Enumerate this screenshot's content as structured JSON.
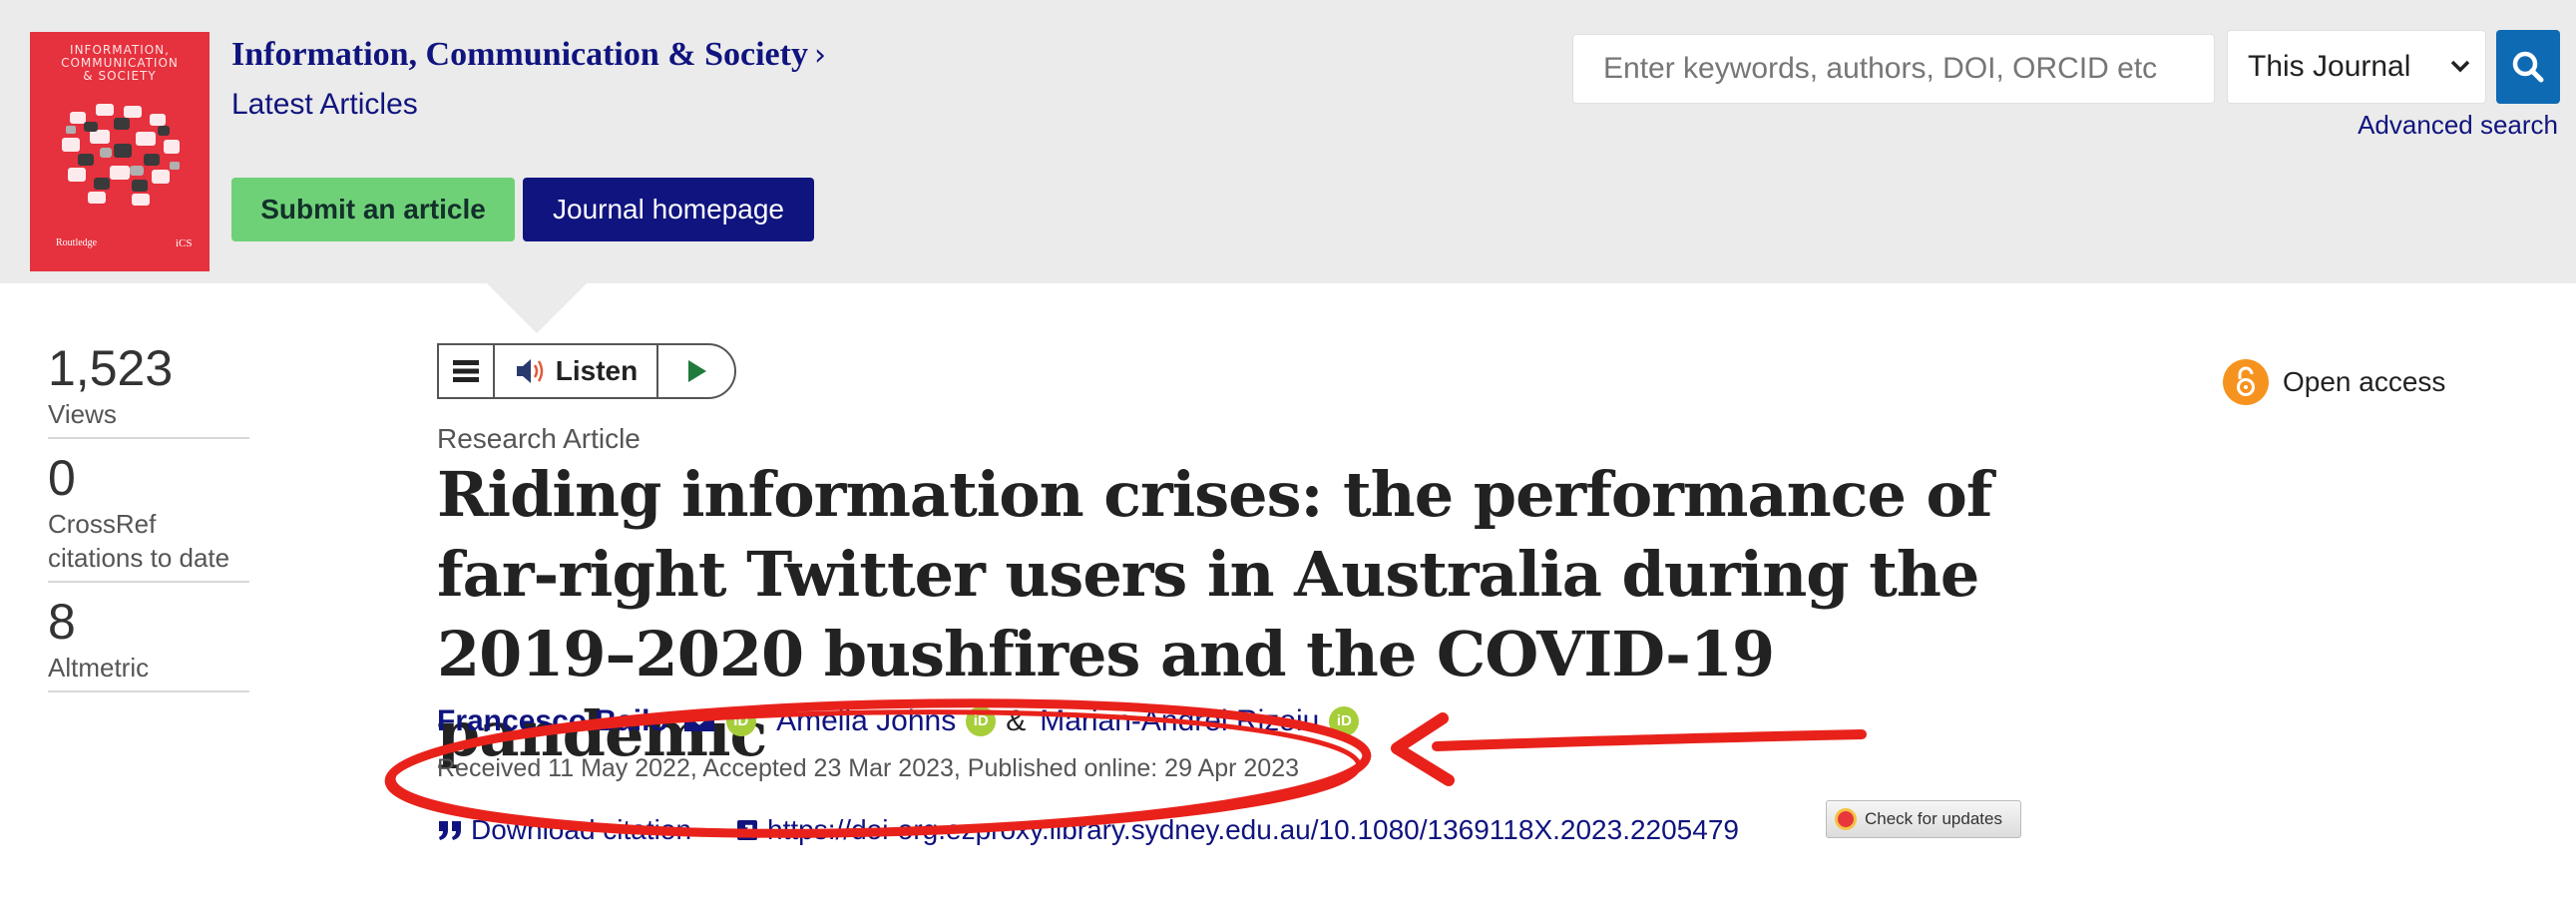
{
  "journal": {
    "cover_title_line1": "INFORMATION,",
    "cover_title_line2": "COMMUNICATION",
    "cover_title_line3": "& SOCIETY",
    "cover_publisher": "Routledge",
    "cover_abbr": "iCS",
    "title": "Information, Communication & Society",
    "title_chevron": "›",
    "subtitle": "Latest Articles",
    "submit_label": "Submit an article",
    "homepage_label": "Journal homepage"
  },
  "search": {
    "placeholder": "Enter keywords, authors, DOI, ORCID etc",
    "scope_value": "This Journal",
    "advanced_label": "Advanced search"
  },
  "metrics": [
    {
      "value": "1,523",
      "label": "Views"
    },
    {
      "value": "0",
      "label": "CrossRef citations to date"
    },
    {
      "value": "8",
      "label": "Altmetric"
    }
  ],
  "listen": {
    "label": "Listen"
  },
  "access": {
    "label": "Open access"
  },
  "article": {
    "type": "Research Article",
    "title": "Riding information crises: the performance of far-right Twitter users in Australia during the 2019–2020 bushfires and the COVID-19 pandemic",
    "authors": [
      {
        "name": "Francesco Bailo"
      },
      {
        "name": "Amelia Johns"
      },
      {
        "name": "Marian-Andrei Rizoiu"
      }
    ],
    "author_sep_1": ",",
    "author_sep_2": "&",
    "orcid_label": "iD",
    "dates": "Received 11 May 2022, Accepted 23 Mar 2023, Published online: 29 Apr 2023",
    "download_label": "Download citation",
    "doi_link": "https://doi-org.ezproxy.library.sydney.edu.au/10.1080/1369118X.2023.2205479",
    "check_updates_label": "Check for updates"
  },
  "colors": {
    "navy": "#10147e",
    "submit_green": "#6fd177",
    "search_blue": "#0f6ab4",
    "open_access_orange": "#f6931e",
    "orcid_green": "#a6ce39",
    "annotation_red": "#e8221b"
  },
  "icons": [
    "search-icon",
    "chevron-down-icon",
    "menu-icon",
    "speaker-icon",
    "play-icon",
    "open-access-lock-icon",
    "envelope-icon",
    "orcid-icon",
    "quote-icon",
    "external-link-icon",
    "crossmark-icon"
  ]
}
